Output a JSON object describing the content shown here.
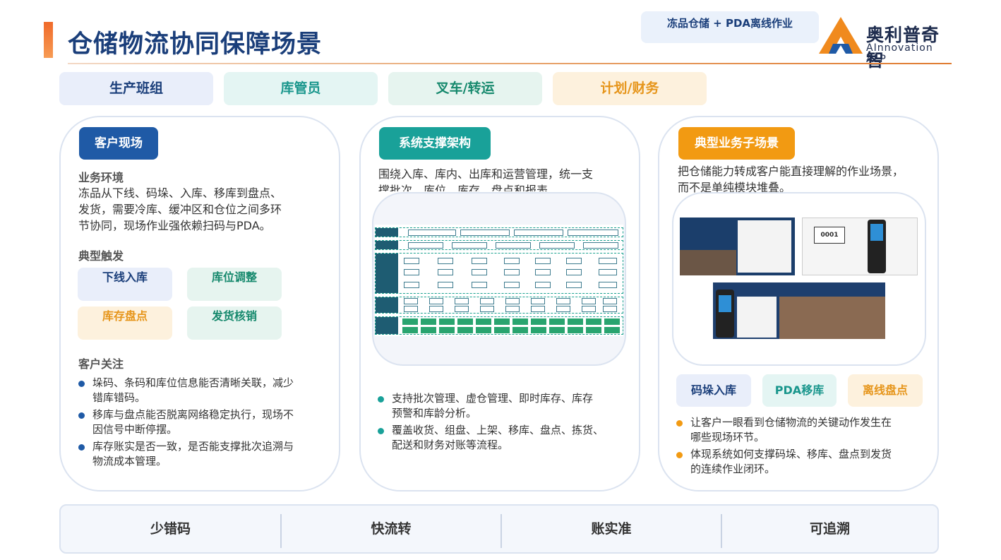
{
  "header": {
    "title": "仓储物流协同保障场景",
    "scene_tag": "冻品仓储 + PDA离线作业",
    "logo_cn": "奥利普奇智",
    "logo_en": "AInnovation ALP"
  },
  "roles": [
    "生产班组",
    "库管员",
    "叉车/转运",
    "计划/财务"
  ],
  "card1": {
    "heading": "客户现场",
    "env_label": "业务环境",
    "env_lines": [
      "冻品从下线、码垛、入库、移库到盘点、",
      "发货，需要冷库、缓冲区和仓位之间多环",
      "节协同，现场作业强依赖扫码与PDA。"
    ],
    "trigger_label": "典型触发",
    "triggers": [
      "下线入库",
      "库位调整",
      "库存盘点",
      "发货核销"
    ],
    "focus_label": "客户关注",
    "focus": [
      [
        "垛码、条码和库位信息能否清晰关联，减少",
        "错库错码。"
      ],
      [
        "移库与盘点能否脱离网络稳定执行，现场不",
        "因信号中断停摆。"
      ],
      [
        "库存账实是否一致，是否能支撑批次追溯与",
        "物流成本管理。"
      ]
    ]
  },
  "card2": {
    "heading": "系统支撑架构",
    "intro_lines": [
      "围绕入库、库内、出库和运营管理，统一支",
      "撑批次、库位、库存、盘点和报表。"
    ],
    "points": [
      [
        "支持批次管理、虚仓管理、即时库存、库存",
        "预警和库龄分析。"
      ],
      [
        "覆盖收货、组盘、上架、移库、盘点、拣货、",
        "配送和财务对账等流程。"
      ]
    ]
  },
  "card3": {
    "heading": "典型业务子场景",
    "intro_lines": [
      "把仓储能力转成客户能直接理解的作业场景，",
      "而不是单纯模块堆叠。"
    ],
    "chips": [
      "码垛入库",
      "PDA移库",
      "离线盘点"
    ],
    "points": [
      [
        "让客户一眼看到仓储物流的关键动作发生在",
        "哪些现场环节。"
      ],
      [
        "体现系统如何支撑码垛、移库、盘点到发货",
        "的连续作业闭环。"
      ]
    ]
  },
  "kpis": [
    "少错码",
    "快流转",
    "账实准",
    "可追溯"
  ],
  "colors": {
    "navy": "#1a3e7a",
    "blue": "#1f5aa6",
    "teal": "#19a199",
    "green": "#16896d",
    "orange": "#f29a12"
  }
}
